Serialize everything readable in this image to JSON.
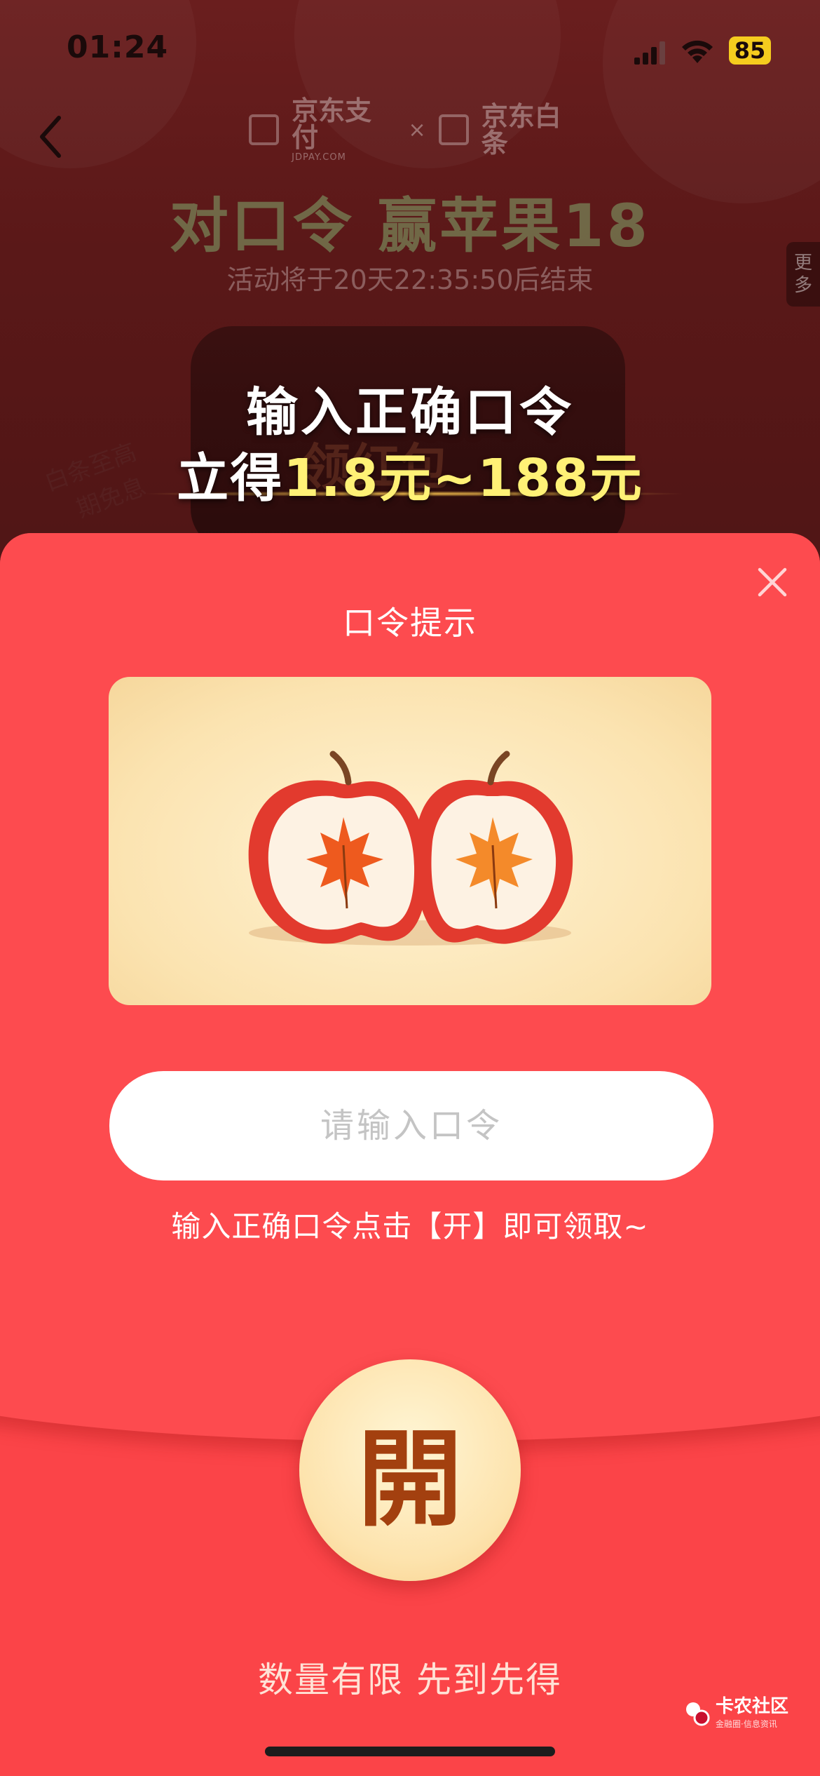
{
  "status_bar": {
    "time": "01:24",
    "battery": "85",
    "icons": [
      "signal-icon",
      "wifi-icon",
      "battery-icon"
    ]
  },
  "background_page": {
    "brand_left": "京东支付",
    "brand_left_sub": "JDPAY.COM",
    "brand_right": "京东白条",
    "brand_times": "×",
    "title": "对口令 赢苹果18",
    "countdown": "活动将于20天22:35:50后结束",
    "more_tab": [
      "更",
      "多"
    ],
    "banner_line1": "输入正确口令",
    "banner_line2_prefix": "立得",
    "banner_line2_amount": "1.8元~188元",
    "ghost_text": "领红包",
    "handwriting": [
      "白条至高",
      "期免息"
    ]
  },
  "packet": {
    "hint_title": "口令提示",
    "input_placeholder": "请输入口令",
    "input_value": "",
    "hint_note": "输入正确口令点击【开】即可领取~",
    "open_label": "開",
    "footer_note": "数量有限 先到先得"
  },
  "watermark": {
    "text": "卡农社区",
    "sub": "金融圈·信息资讯"
  },
  "colors": {
    "packet_red": "#fb4448",
    "open_button_gold": "#fde3ad",
    "open_text": "#a3400f",
    "amount_yellow": "#fff176",
    "battery_yellow": "#f5cc1e"
  }
}
